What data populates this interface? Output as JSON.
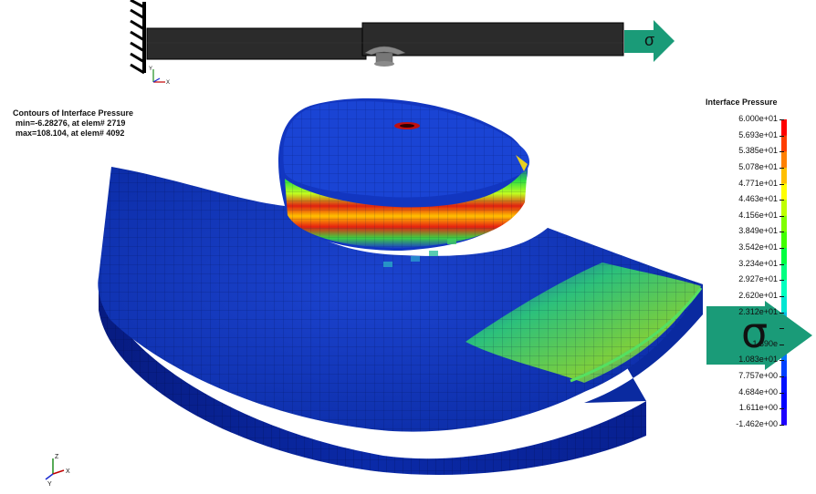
{
  "contour_title": {
    "line1": "Contours of Interface Pressure",
    "line2": "min=-6.28276, at elem# 2719",
    "line3": "max=108.104, at elem# 4092"
  },
  "legend": {
    "title": "Interface Pressure",
    "labels": [
      "6.000e+01",
      "5.693e+01",
      "5.385e+01",
      "5.078e+01",
      "4.771e+01",
      "4.463e+01",
      "4.156e+01",
      "3.849e+01",
      "3.542e+01",
      "3.234e+01",
      "2.927e+01",
      "2.620e+01",
      "2.312e+01",
      "",
      "1.390e",
      "1.083e+01",
      "7.757e+00",
      "4.684e+00",
      "1.611e+00",
      "-1.462e+00"
    ],
    "colors": [
      "#ff0000",
      "#ff3d00",
      "#ff8000",
      "#ffbf00",
      "#ffff00",
      "#bfff00",
      "#80ff00",
      "#40ff00",
      "#00ff40",
      "#00ff80",
      "#00ffbf",
      "#00e6d2",
      "#00bfe6",
      "#0099ff",
      "#0073ff",
      "#0040ff",
      "#0010ff",
      "#0000ff",
      "#1e00ff"
    ]
  },
  "arrows": {
    "small_symbol": "σ",
    "big_symbol": "σ",
    "color": "#1a9b78"
  },
  "colors": {
    "mesh_blue": "#0a2fb0",
    "mesh_dark": "#071f85",
    "beam": "#2b2b2b"
  },
  "axes": {
    "y": "Y",
    "z": "Z",
    "x": "X"
  }
}
